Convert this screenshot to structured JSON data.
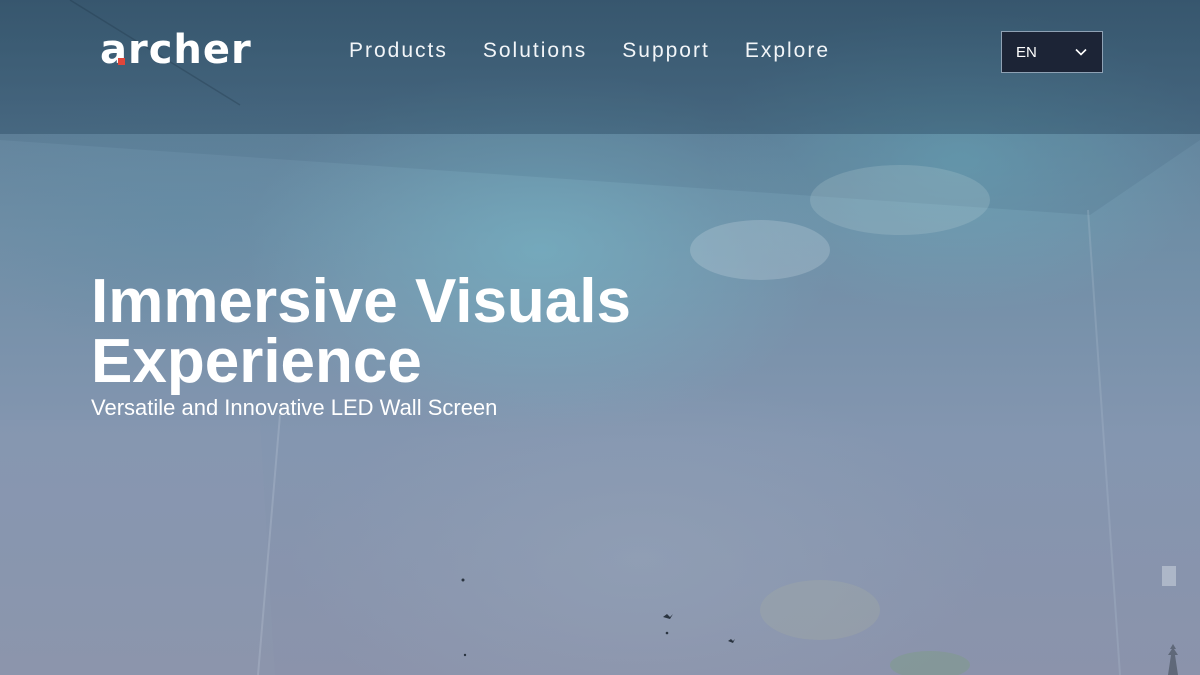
{
  "brand": {
    "name": "archer",
    "accent_color": "#e0463a"
  },
  "nav": {
    "items": [
      {
        "label": "Products"
      },
      {
        "label": "Solutions"
      },
      {
        "label": "Support"
      },
      {
        "label": "Explore"
      }
    ]
  },
  "language": {
    "selected": "EN",
    "icon": "chevron-down-icon"
  },
  "hero": {
    "title_line1": "Immersive Visuals",
    "title_line2": "Experience",
    "subtitle": "Versatile and Innovative LED Wall Screen"
  }
}
